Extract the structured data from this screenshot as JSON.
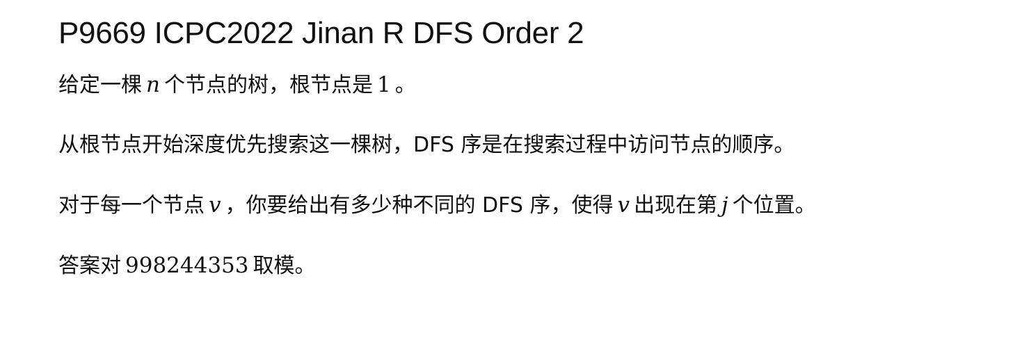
{
  "title": "P9669 ICPC2022 Jinan R DFS Order 2",
  "p1": {
    "t1": "给定一棵",
    "m1": "n",
    "t2": "个节点的树，根节点是",
    "m2": "1",
    "t3": "。"
  },
  "p2": {
    "t1": "从根节点开始深度优先搜索这一棵树，DFS 序是在搜索过程中访问节点的顺序。"
  },
  "p3": {
    "t1": "对于每一个节点",
    "m1": "v",
    "t2": "，你要给出有多少种不同的 DFS 序，使得",
    "m2": "v",
    "t3": "出现在第",
    "m3": "j",
    "t4": "个位置。"
  },
  "p4": {
    "t1": "答案对",
    "m1": "998244353",
    "t2": "取模。"
  }
}
